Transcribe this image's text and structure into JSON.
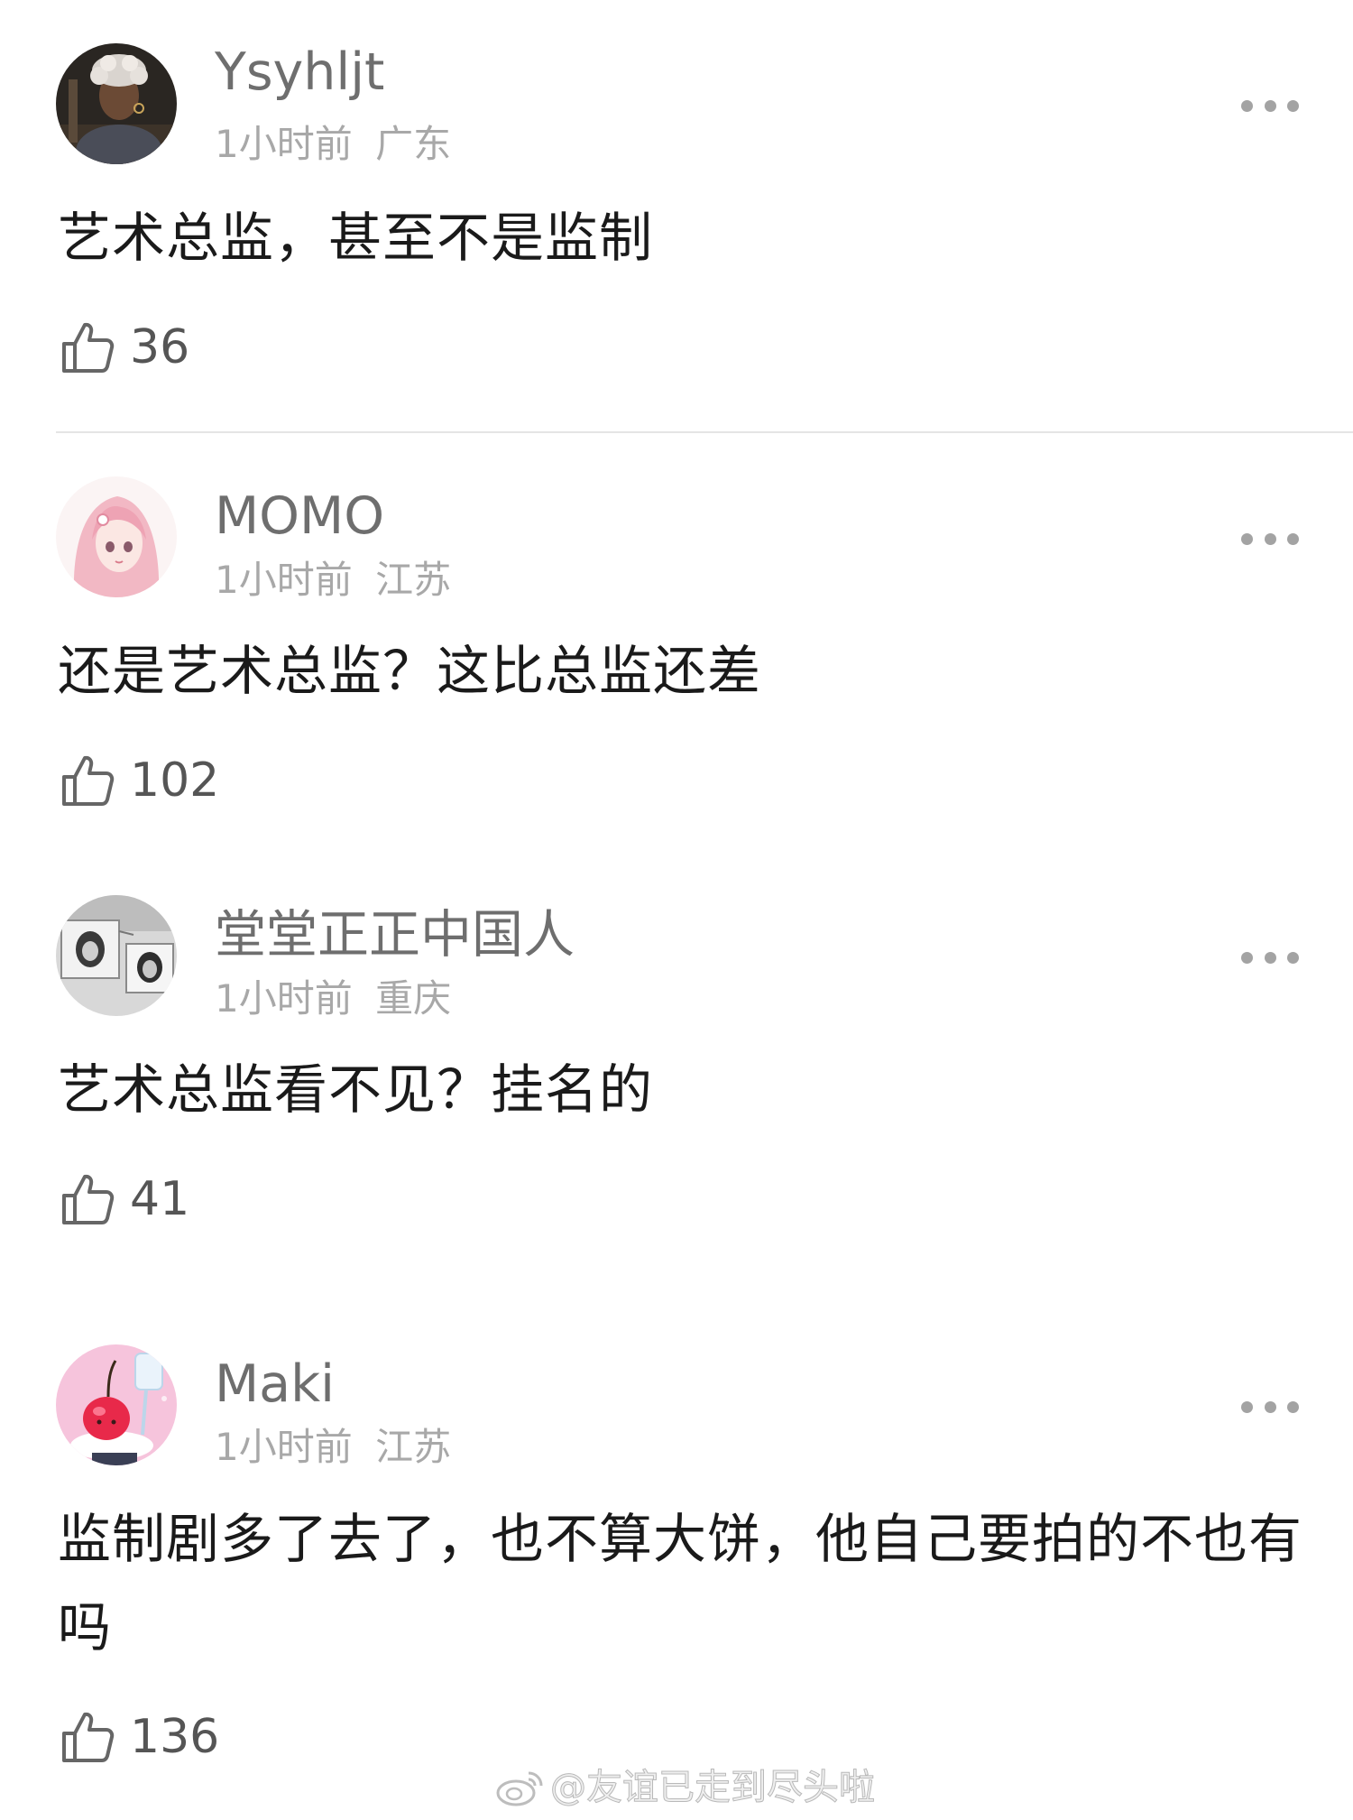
{
  "comments": [
    {
      "username": "Ysyhljt",
      "time": "1小时前",
      "location": "广东",
      "text": "艺术总监，甚至不是监制",
      "likes": "36",
      "avatar": "avatar-dark-person"
    },
    {
      "username": "MOMO",
      "time": "1小时前",
      "location": "江苏",
      "text": "还是艺术总监？这比总监还差",
      "likes": "102",
      "avatar": "avatar-pink-anime-girl"
    },
    {
      "username": "堂堂正正中国人",
      "time": "1小时前",
      "location": "重庆",
      "text": "艺术总监看不见？挂名的",
      "likes": "41",
      "avatar": "avatar-grayscale-photos"
    },
    {
      "username": "Maki",
      "time": "1小时前",
      "location": "江苏",
      "text": "监制剧多了去了，也不算大饼，他自己要拍的不也有吗",
      "likes": "136",
      "avatar": "avatar-cherry-dessert"
    }
  ],
  "icons": {
    "like": "thumbs-up-icon",
    "more": "more-dots-icon",
    "watermark": "weibo-logo-icon"
  },
  "watermark": {
    "text": "@友谊已走到尽头啦"
  },
  "colors": {
    "username": "#6e6e6e",
    "meta": "#a8a8a8",
    "body_text": "#1a1a1a",
    "like_count": "#555555",
    "divider": "#e5e5e5"
  }
}
